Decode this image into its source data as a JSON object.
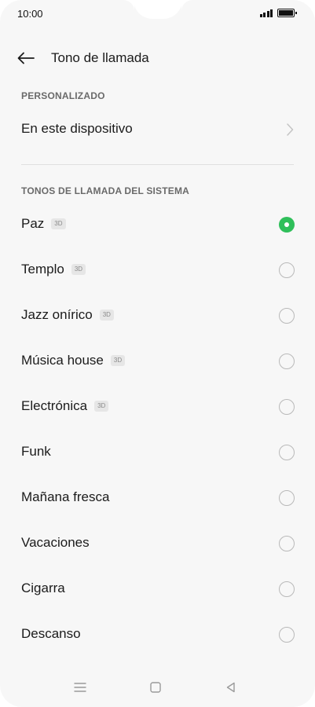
{
  "status_bar": {
    "time": "10:00",
    "icons": [
      "signal-icon",
      "battery-icon"
    ]
  },
  "header": {
    "back_icon": "arrow-left-icon",
    "title": "Tono de llamada"
  },
  "custom_section": {
    "header": "PERSONALIZADO",
    "item_label": "En este dispositivo",
    "item_icon": "chevron-right-icon"
  },
  "system_section": {
    "header": "TONOS DE LLAMADA DEL SISTEMA",
    "badge": "3D",
    "accent_color": "#2fbf5a",
    "items": [
      {
        "label": "Paz",
        "badge": "3D",
        "selected": true
      },
      {
        "label": "Templo",
        "badge": "3D",
        "selected": false
      },
      {
        "label": "Jazz onírico",
        "badge": "3D",
        "selected": false
      },
      {
        "label": "Música house",
        "badge": "3D",
        "selected": false
      },
      {
        "label": "Electrónica",
        "badge": "3D",
        "selected": false
      },
      {
        "label": "Funk",
        "badge": "",
        "selected": false
      },
      {
        "label": "Mañana fresca",
        "badge": "",
        "selected": false
      },
      {
        "label": "Vacaciones",
        "badge": "",
        "selected": false
      },
      {
        "label": "Cigarra",
        "badge": "",
        "selected": false
      },
      {
        "label": "Descanso",
        "badge": "",
        "selected": false
      }
    ]
  },
  "nav_bar": {
    "icons": [
      "menu-icon",
      "home-square-icon",
      "back-triangle-icon"
    ]
  }
}
